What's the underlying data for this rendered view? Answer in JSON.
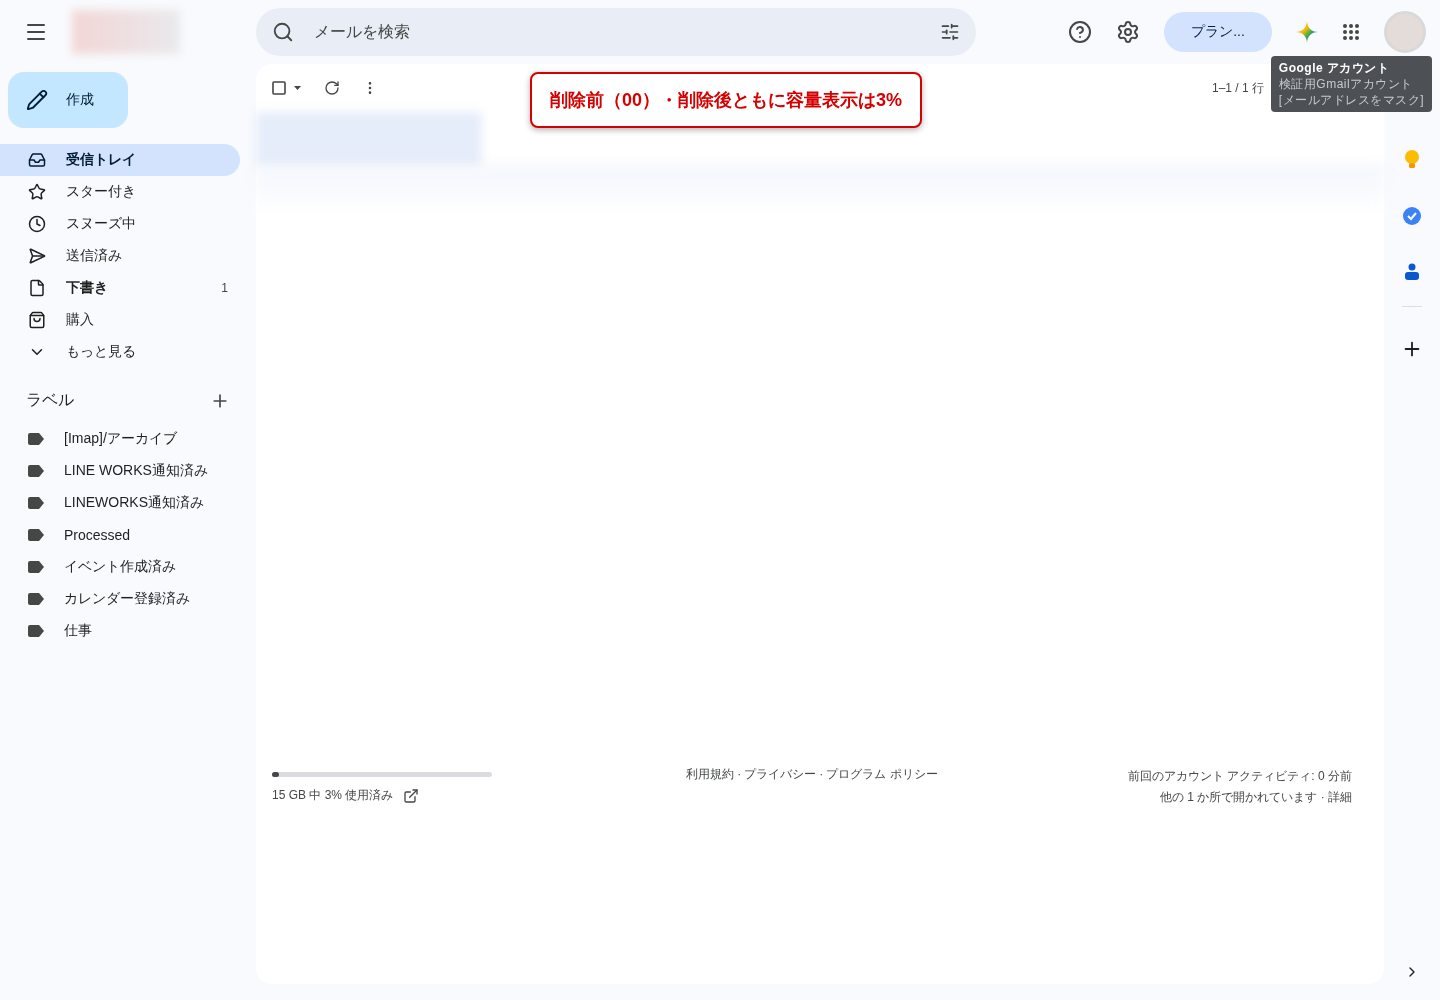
{
  "search": {
    "placeholder": "メールを検索"
  },
  "plan_button": {
    "label": "プラン..."
  },
  "compose": {
    "label": "作成"
  },
  "nav": [
    {
      "kind": "inbox",
      "label": "受信トレイ",
      "selected": true,
      "unread": true
    },
    {
      "kind": "star",
      "label": "スター付き",
      "selected": false,
      "unread": false
    },
    {
      "kind": "snooze",
      "label": "スヌーズ中",
      "selected": false,
      "unread": false
    },
    {
      "kind": "sent",
      "label": "送信済み",
      "selected": false,
      "unread": false
    },
    {
      "kind": "draft",
      "label": "下書き",
      "selected": false,
      "unread": true,
      "count": "1"
    },
    {
      "kind": "purchase",
      "label": "購入",
      "selected": false,
      "unread": false
    },
    {
      "kind": "more",
      "label": "もっと見る",
      "selected": false,
      "unread": false
    }
  ],
  "labels": {
    "title": "ラベル",
    "items": [
      "[Imap]/アーカイブ",
      "LINE WORKS通知済み",
      "LINEWORKS通知済み",
      "Processed",
      "イベント作成済み",
      "カレンダー登録済み",
      "仕事"
    ]
  },
  "toolbar": {
    "pagination": "1–1 / 1 行"
  },
  "annotation": {
    "text": "削除前（00）・削除後ともに容量表示は3%"
  },
  "account_tooltip": {
    "title": "Google アカウント",
    "lines": [
      "検証用Gmailアカウント",
      "[メールアドレスをマスク]"
    ]
  },
  "footer": {
    "storage": {
      "level": 0.03,
      "text": "15 GB 中 3% 使用済み"
    },
    "links": [
      "利用規約",
      "プライバシー",
      "プログラム ポリシー"
    ],
    "link_separator": "·",
    "activity": [
      "前回のアカウント アクティビティ: 0 分前",
      "他の 1 か所で開かれています · 詳細"
    ]
  }
}
